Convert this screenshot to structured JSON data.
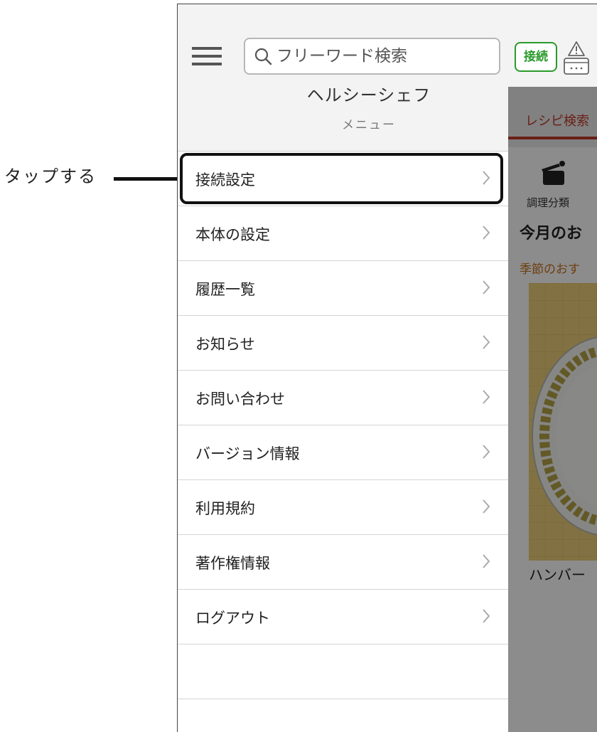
{
  "callout": {
    "label": "タップする"
  },
  "header": {
    "search_placeholder": "フリーワード検索",
    "connect_label": "接続",
    "app_title": "ヘルシーシェフ",
    "menu_caption": "メニュー"
  },
  "menu": {
    "items": [
      {
        "label": "接続設定"
      },
      {
        "label": "本体の設定"
      },
      {
        "label": "履歴一覧"
      },
      {
        "label": "お知らせ"
      },
      {
        "label": "お問い合わせ"
      },
      {
        "label": "バージョン情報"
      },
      {
        "label": "利用規約"
      },
      {
        "label": "著作権情報"
      },
      {
        "label": "ログアウト"
      },
      {
        "label": ""
      }
    ],
    "highlighted_index": 0
  },
  "background_app": {
    "tab_label": "レシピ検索",
    "category_label": "調理分類",
    "heading": "今月のお",
    "subheading": "季節のおす",
    "caption": "ハンバー"
  },
  "colors": {
    "connect_green": "#2a9a2a",
    "tab_red": "#c0392b",
    "subheading_orange": "#c9731e"
  },
  "icons": {
    "hamburger": "hamburger-icon",
    "search": "search-icon",
    "device_warning": "device-warning-icon",
    "chevron": "chevron-right-icon",
    "pot": "pot-icon"
  }
}
